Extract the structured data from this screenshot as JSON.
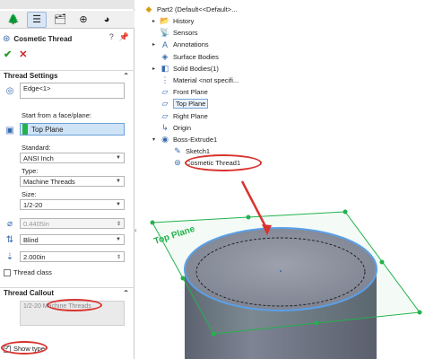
{
  "property_manager": {
    "tabs": [
      {
        "name": "feature-manager-tab",
        "glyph": "🌲"
      },
      {
        "name": "property-manager-tab",
        "glyph": "☰"
      },
      {
        "name": "configuration-tab",
        "glyph": "🗂"
      },
      {
        "name": "dimxpert-tab",
        "glyph": "⊕"
      },
      {
        "name": "display-tab",
        "glyph": "◕"
      }
    ],
    "title": "Cosmetic Thread",
    "title_icons": [
      "?",
      "📌"
    ],
    "ok": "✔",
    "cancel": "✕",
    "thread_settings": {
      "heading": "Thread Settings",
      "edge_value": "Edge<1>",
      "start_label": "Start from a face/plane:",
      "start_value": "Top Plane",
      "standard_label": "Standard:",
      "standard_value": "ANSI Inch",
      "type_label": "Type:",
      "type_value": "Machine Threads",
      "size_label": "Size:",
      "size_value": "1/2-20",
      "diameter_value": "0.4405in",
      "end_condition_value": "Blind",
      "depth_value": "2.000in",
      "thread_class_label": "Thread class"
    },
    "thread_callout": {
      "heading": "Thread Callout",
      "text_prefix": "1/2-20 ",
      "text_highlight": "Machine Threads",
      "show_type_label": "Show type"
    }
  },
  "feature_tree": {
    "root": "Part2  (Default<<Default>...",
    "items": [
      {
        "label": "History",
        "icon": "📂",
        "indent": 1,
        "expand": "▸"
      },
      {
        "label": "Sensors",
        "icon": "📡",
        "indent": 1,
        "expand": ""
      },
      {
        "label": "Annotations",
        "icon": "A",
        "indent": 1,
        "expand": "▸"
      },
      {
        "label": "Surface Bodies",
        "icon": "◈",
        "indent": 1,
        "expand": ""
      },
      {
        "label": "Solid Bodies(1)",
        "icon": "◧",
        "indent": 1,
        "expand": "▸"
      },
      {
        "label": "Material <not specifi...",
        "icon": "⋮",
        "indent": 1,
        "expand": ""
      },
      {
        "label": "Front Plane",
        "icon": "▱",
        "indent": 1,
        "expand": ""
      },
      {
        "label": "Top Plane",
        "icon": "▱",
        "indent": 1,
        "expand": "",
        "selected": true
      },
      {
        "label": "Right Plane",
        "icon": "▱",
        "indent": 1,
        "expand": ""
      },
      {
        "label": "Origin",
        "icon": "↳",
        "indent": 1,
        "expand": ""
      },
      {
        "label": "Boss-Extrude1",
        "icon": "◉",
        "indent": 1,
        "expand": "▾"
      },
      {
        "label": "Sketch1",
        "icon": "✎",
        "indent": 2,
        "expand": ""
      },
      {
        "label": "Cosmetic Thread1",
        "icon": "⊛",
        "indent": 2,
        "expand": "",
        "highlighted": true
      }
    ]
  },
  "graphics": {
    "plane_label": "Top Plane",
    "colors": {
      "plane": "#22b24c",
      "edge_highlight": "#5aa0e8",
      "cylinder_top": "#8a8f9c",
      "cylinder_side": "#6e7382",
      "annotation_red": "#d9332f"
    }
  }
}
